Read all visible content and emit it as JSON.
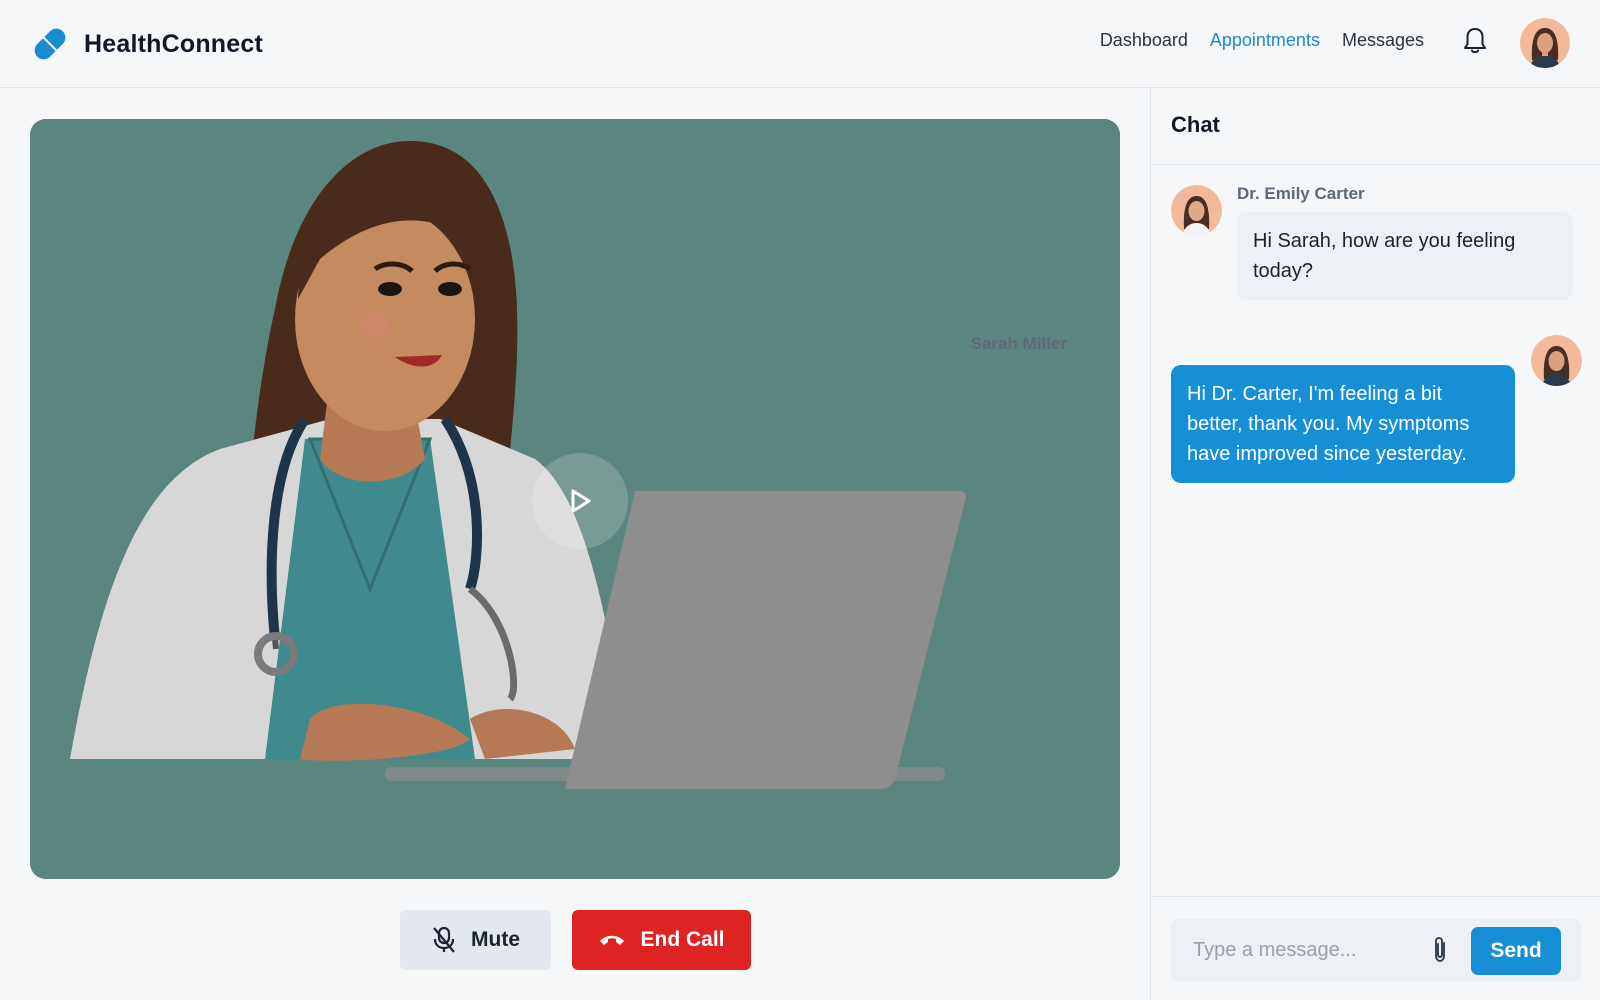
{
  "app": {
    "title": "HealthConnect",
    "logo_icon": "pill-logo-icon",
    "brand_color": "#1a8bd0"
  },
  "nav": {
    "items": [
      {
        "label": "Dashboard",
        "active": false
      },
      {
        "label": "Appointments",
        "active": true
      },
      {
        "label": "Messages",
        "active": false
      }
    ],
    "bell_icon": "bell-icon",
    "user_avatar": "user-avatar"
  },
  "video": {
    "play_icon": "play-icon",
    "background_color": "#5b857f"
  },
  "controls": {
    "mute_label": "Mute",
    "mute_icon": "mic-off-icon",
    "end_call_label": "End Call",
    "end_call_icon": "phone-hangup-icon",
    "end_call_color": "#de2323"
  },
  "chat": {
    "title": "Chat",
    "messages": [
      {
        "sender": "Dr. Emily Carter",
        "text": "Hi Sarah, how are you feeling today?",
        "direction": "incoming"
      },
      {
        "sender": "Sarah Miller",
        "text": "Hi Dr. Carter, I'm feeling a bit better, thank you. My symptoms have improved since yesterday.",
        "direction": "outgoing"
      }
    ],
    "input_placeholder": "Type a message...",
    "input_value": "",
    "attach_icon": "paperclip-icon",
    "send_label": "Send"
  }
}
